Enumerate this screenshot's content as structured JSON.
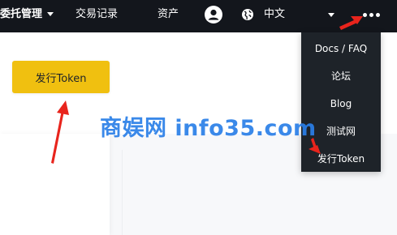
{
  "nav": {
    "entrust": "委托管理",
    "trades": "交易记录",
    "assets": "资产",
    "language": "中文",
    "avatar_icon": "user-avatar-icon",
    "globe_icon": "globe-icon",
    "more_icon": "more-dots-icon"
  },
  "main": {
    "issue_button": "发行Token"
  },
  "more_menu": {
    "items": [
      "Docs / FAQ",
      "论坛",
      "Blog",
      "测试网",
      "发行Token"
    ]
  },
  "watermark": "商娱网 info35.com",
  "colors": {
    "nav_background": "#13161c",
    "menu_background": "#1e2329",
    "accent_yellow": "#f0c010",
    "annotation_red": "#e8241c",
    "watermark_blue": "#2a7fe8"
  }
}
